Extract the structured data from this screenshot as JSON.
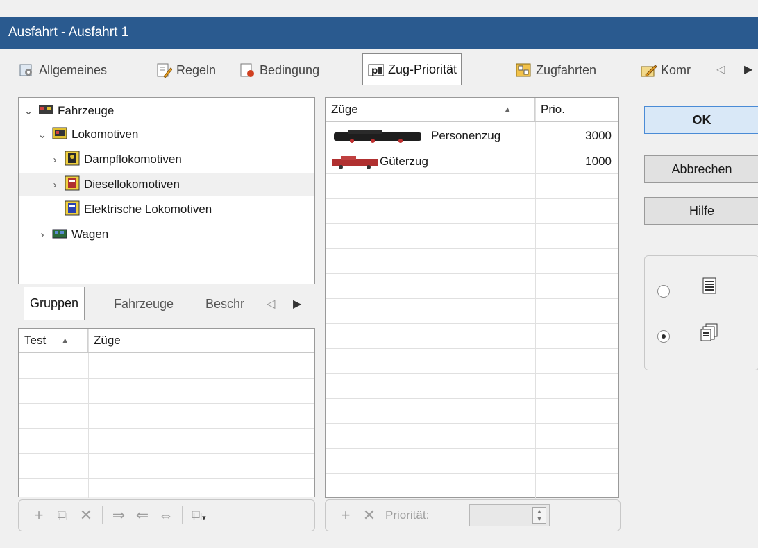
{
  "window": {
    "title": "Ausfahrt - Ausfahrt 1"
  },
  "main_tabs": [
    {
      "label": "Allgemeines",
      "icon": "settings-doc-icon"
    },
    {
      "label": "Regeln",
      "icon": "pencil-doc-icon"
    },
    {
      "label": "Bedingung",
      "icon": "condition-doc-icon"
    },
    {
      "label": "Zug-Priorität",
      "icon": "priority-icon",
      "active": true
    },
    {
      "label": "Zugfahrten",
      "icon": "train-runs-icon"
    },
    {
      "label": "Komr",
      "icon": "comment-icon"
    }
  ],
  "tabs_more": "◁",
  "tabs_next": "▶",
  "tree": {
    "items": [
      {
        "label": "Fahrzeuge",
        "level": 0,
        "chevron": "expanded"
      },
      {
        "label": "Lokomotiven",
        "level": 1,
        "chevron": "expanded"
      },
      {
        "label": "Dampflokomotiven",
        "level": 2,
        "chevron": "collapsed"
      },
      {
        "label": "Diesellokomotiven",
        "level": 2,
        "chevron": "collapsed",
        "selected": true
      },
      {
        "label": "Elektrische Lokomotiven",
        "level": 2,
        "chevron": "none"
      },
      {
        "label": "Wagen",
        "level": 1,
        "chevron": "collapsed"
      }
    ]
  },
  "sub_tabs": [
    {
      "label": "Gruppen",
      "active": true
    },
    {
      "label": "Fahrzeuge"
    },
    {
      "label": "Beschr"
    }
  ],
  "tests_table": {
    "columns": [
      "Test",
      "Züge"
    ],
    "sort_indicator": "▲"
  },
  "trains_table": {
    "columns": [
      "Züge",
      "Prio."
    ],
    "sort_indicator": "▲",
    "rows": [
      {
        "name": "Personenzug",
        "prio": "3000"
      },
      {
        "name": "Güterzug",
        "prio": "1000"
      }
    ]
  },
  "buttons": {
    "ok": "OK",
    "cancel": "Abbrechen",
    "help": "Hilfe"
  },
  "priority_label": "Priorität:"
}
